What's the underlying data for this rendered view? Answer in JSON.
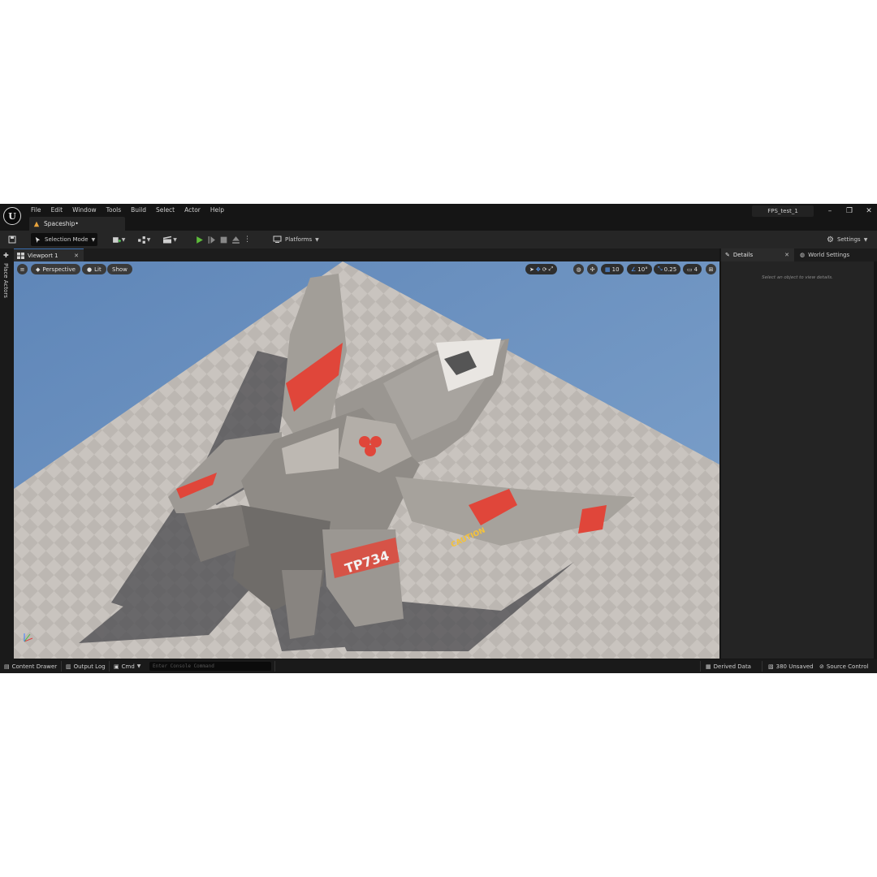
{
  "menu": [
    "File",
    "Edit",
    "Window",
    "Tools",
    "Build",
    "Select",
    "Actor",
    "Help"
  ],
  "document_tab": "Spaceship•",
  "project_name": "FPS_test_1",
  "window_controls": [
    "–",
    "❐",
    "✕"
  ],
  "toolbar": {
    "selection_mode": "Selection Mode",
    "platforms": "Platforms",
    "settings": "Settings"
  },
  "left_panel": {
    "label": "Place Actors"
  },
  "viewport": {
    "tab_label": "Viewport 1",
    "perspective": "Perspective",
    "lit": "Lit",
    "show": "Show",
    "grid_snap": "10",
    "rotation_snap": "10°",
    "scale_snap": "0.25",
    "camera_speed": "4",
    "hull_number": "TP734",
    "caution_text": "CAUTION",
    "sky_color": "#6d93c2",
    "accent_color": "#e0463a"
  },
  "details": {
    "tab_details": "Details",
    "tab_world": "World Settings",
    "hint": "Select an object to view details."
  },
  "statusbar": {
    "content_drawer": "Content Drawer",
    "output_log": "Output Log",
    "cmd": "Cmd",
    "console_placeholder": "Enter Console Command",
    "derived_data": "Derived Data",
    "unsaved": "380 Unsaved",
    "source_control": "Source Control"
  }
}
